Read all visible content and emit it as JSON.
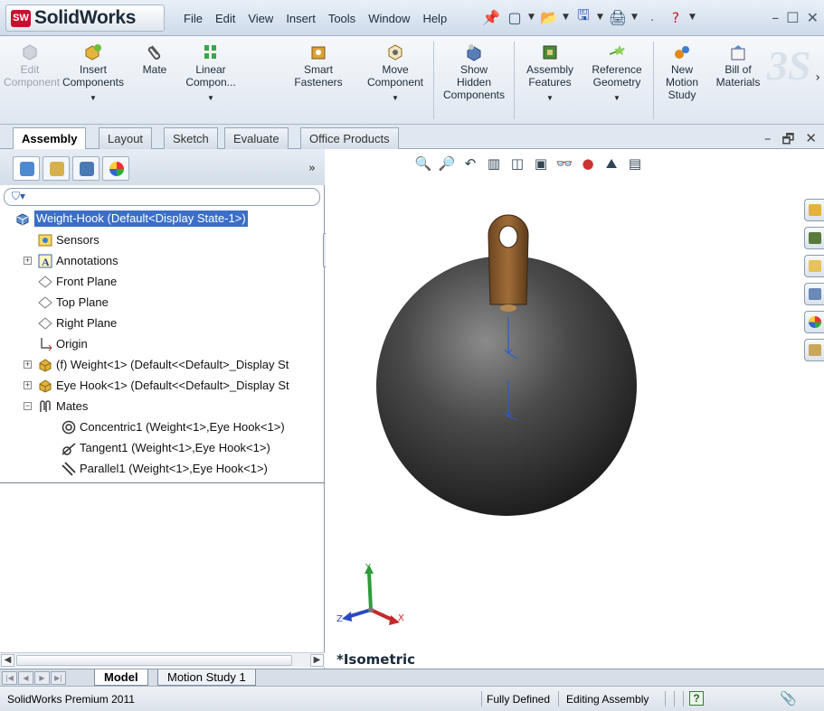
{
  "app": {
    "title": "SolidWorks",
    "badge": "SW"
  },
  "menus": [
    "File",
    "Edit",
    "View",
    "Insert",
    "Tools",
    "Window",
    "Help"
  ],
  "ribbon": {
    "edit_component": "Edit\nComponent",
    "insert_components": "Insert\nComponents",
    "mate": "Mate",
    "linear_component": "Linear\nCompon...",
    "smart_fasteners": "Smart\nFasteners",
    "move_component": "Move\nComponent",
    "show_hidden": "Show\nHidden\nComponents",
    "assembly_features": "Assembly\nFeatures",
    "reference_geometry": "Reference\nGeometry",
    "new_motion_study": "New\nMotion\nStudy",
    "bill_of_materials": "Bill of\nMaterials"
  },
  "command_tabs": [
    "Assembly",
    "Layout",
    "Sketch",
    "Evaluate",
    "Office Products"
  ],
  "tree": {
    "root": "Weight-Hook  (Default<Display State-1>)",
    "items": [
      "Sensors",
      "Annotations",
      "Front Plane",
      "Top Plane",
      "Right Plane",
      "Origin",
      "(f) Weight<1> (Default<<Default>_Display St",
      "Eye Hook<1> (Default<<Default>_Display St",
      "Mates",
      "Concentric1 (Weight<1>,Eye Hook<1>)",
      "Tangent1 (Weight<1>,Eye Hook<1>)",
      "Parallel1 (Weight<1>,Eye Hook<1>)"
    ]
  },
  "viewport": {
    "view_label": "*Isometric",
    "triad": {
      "x": "X",
      "y": "Y",
      "z": "Z"
    }
  },
  "bottom_tabs": [
    "Model",
    "Motion Study 1"
  ],
  "status": {
    "product": "SolidWorks Premium 2011",
    "state": "Fully Defined",
    "mode": "Editing Assembly",
    "help": "?"
  },
  "colors": {
    "selection": "#3b6fc7",
    "sphere": "#3a3a3a",
    "hook": "#8a5a2b"
  }
}
